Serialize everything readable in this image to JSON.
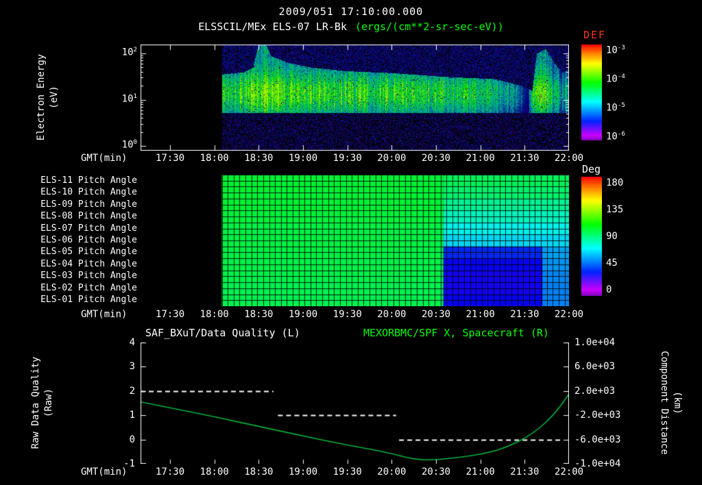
{
  "colors": {
    "background": "#000000",
    "text": "#ffffff",
    "green": "#00ff00",
    "red": "#ff3318",
    "curve_green": "#00b43c"
  },
  "header": {
    "timestamp": "2009/051 17:10:00.000",
    "instrument": "ELSSCIL/MEx ELS-07 LR-Bk",
    "units": "(ergs/(cm**2-sr-sec-eV))"
  },
  "time_axis": {
    "label": "GMT(min)",
    "start_min": 0,
    "end_min": 290,
    "ticks": [
      {
        "min": 20,
        "label": "17:30"
      },
      {
        "min": 50,
        "label": "18:00"
      },
      {
        "min": 80,
        "label": "18:30"
      },
      {
        "min": 110,
        "label": "19:00"
      },
      {
        "min": 140,
        "label": "19:30"
      },
      {
        "min": 170,
        "label": "20:00"
      },
      {
        "min": 200,
        "label": "20:30"
      },
      {
        "min": 230,
        "label": "21:00"
      },
      {
        "min": 260,
        "label": "21:30"
      },
      {
        "min": 290,
        "label": "22:00"
      }
    ]
  },
  "chart_data": [
    {
      "id": "electron_spectrogram",
      "type": "heatmap",
      "title": "ELSSCIL/MEx ELS-07 LR-Bk",
      "units": "ergs/(cm**2-sr-sec-eV)",
      "ylabel": "Electron Energy",
      "ylabel_units": "(eV)",
      "yscale": "log",
      "y_ticks": [
        {
          "base": "10",
          "exp": "2",
          "value": 2
        },
        {
          "base": "10",
          "exp": "1",
          "value": 1
        },
        {
          "base": "10",
          "exp": "0",
          "value": 0
        }
      ],
      "y_exp_top": 2.19,
      "y_exp_bottom": -0.1,
      "colorbar": {
        "title": "DEF",
        "ticks": [
          {
            "base": "10",
            "exp": "-3"
          },
          {
            "base": "10",
            "exp": "-4"
          },
          {
            "base": "10",
            "exp": "-5"
          },
          {
            "base": "10",
            "exp": "-6"
          }
        ]
      },
      "data_start_min": 55,
      "band_low_exp": 0.72,
      "band_core_exp": 1.15,
      "brightness_envelope": [
        [
          55,
          0.82
        ],
        [
          70,
          0.85
        ],
        [
          78,
          1.0
        ],
        [
          90,
          0.98
        ],
        [
          105,
          0.9
        ],
        [
          130,
          0.85
        ],
        [
          160,
          0.83
        ],
        [
          200,
          0.8
        ],
        [
          235,
          0.75
        ],
        [
          252,
          0.55
        ],
        [
          262,
          0.35
        ],
        [
          266,
          0.9
        ],
        [
          272,
          0.95
        ],
        [
          280,
          0.7
        ],
        [
          285,
          0.55
        ],
        [
          290,
          0.65
        ]
      ],
      "band_top_exp_envelope": [
        [
          55,
          1.55
        ],
        [
          70,
          1.6
        ],
        [
          76,
          1.7
        ],
        [
          80,
          2.25
        ],
        [
          84,
          2.25
        ],
        [
          88,
          1.95
        ],
        [
          100,
          1.8
        ],
        [
          115,
          1.7
        ],
        [
          140,
          1.62
        ],
        [
          170,
          1.58
        ],
        [
          205,
          1.5
        ],
        [
          240,
          1.45
        ],
        [
          258,
          1.3
        ],
        [
          265,
          1.2
        ],
        [
          268,
          2.0
        ],
        [
          274,
          2.1
        ],
        [
          280,
          1.8
        ],
        [
          285,
          1.6
        ],
        [
          290,
          1.65
        ]
      ]
    },
    {
      "id": "pitch_angles",
      "type": "heatmap",
      "colorbar": {
        "title": "Deg",
        "ticks": [
          180,
          135,
          90,
          45,
          0
        ],
        "max": 180
      },
      "data_start_min": 55,
      "grid_step_min": 4,
      "rows": [
        {
          "label": "ELS-11 Pitch Angle",
          "segments": [
            [
              55,
              205,
              100
            ],
            [
              205,
              290,
              95
            ]
          ]
        },
        {
          "label": "ELS-10 Pitch Angle",
          "segments": [
            [
              55,
              205,
              100
            ],
            [
              205,
              290,
              92
            ]
          ]
        },
        {
          "label": "ELS-09 Pitch Angle",
          "segments": [
            [
              55,
              205,
              100
            ],
            [
              205,
              290,
              86
            ]
          ]
        },
        {
          "label": "ELS-08 Pitch Angle",
          "segments": [
            [
              55,
              205,
              99
            ],
            [
              205,
              290,
              80
            ]
          ]
        },
        {
          "label": "ELS-07 Pitch Angle",
          "segments": [
            [
              55,
              205,
              98
            ],
            [
              205,
              290,
              73
            ]
          ]
        },
        {
          "label": "ELS-06 Pitch Angle",
          "segments": [
            [
              55,
              205,
              98
            ],
            [
              205,
              290,
              68
            ]
          ]
        },
        {
          "label": "ELS-05 Pitch Angle",
          "segments": [
            [
              55,
              205,
              98
            ],
            [
              205,
              272,
              42
            ],
            [
              272,
              290,
              60
            ]
          ]
        },
        {
          "label": "ELS-04 Pitch Angle",
          "segments": [
            [
              55,
              205,
              97
            ],
            [
              205,
              272,
              35
            ],
            [
              272,
              290,
              58
            ]
          ]
        },
        {
          "label": "ELS-03 Pitch Angle",
          "segments": [
            [
              55,
              205,
              97
            ],
            [
              205,
              272,
              33
            ],
            [
              272,
              290,
              56
            ]
          ]
        },
        {
          "label": "ELS-02 Pitch Angle",
          "segments": [
            [
              55,
              205,
              96
            ],
            [
              205,
              272,
              33
            ],
            [
              272,
              290,
              55
            ]
          ]
        },
        {
          "label": "ELS-01 Pitch Angle",
          "segments": [
            [
              55,
              205,
              96
            ],
            [
              205,
              272,
              35
            ],
            [
              272,
              290,
              55
            ]
          ]
        }
      ]
    },
    {
      "id": "quality_and_distance",
      "type": "line",
      "title_left": "SAF_BXuT/Data Quality (L)",
      "title_right": "MEXORBMC/SPF X, Spacecraft (R)",
      "ylabel_left": "Raw Data Quality",
      "ylabel_left_units": "(Raw)",
      "ylabel_right": "Component Distance",
      "ylabel_right_units": "(km)",
      "left_axis": {
        "min": -1,
        "max": 4,
        "ticks": [
          4,
          3,
          2,
          1,
          0,
          -1
        ]
      },
      "right_axis": {
        "min": -10000,
        "max": 10000,
        "ticks": [
          {
            "value": 10000,
            "label": "1.0e+04"
          },
          {
            "value": 6000,
            "label": "6.0e+03"
          },
          {
            "value": 2000,
            "label": "2.0e+03"
          },
          {
            "value": -2000,
            "label": "-2.0e+03"
          },
          {
            "value": -6000,
            "label": "-6.0e+03"
          },
          {
            "value": -10000,
            "label": "-1.0e+04"
          }
        ]
      },
      "quality_series": {
        "style": "dashed-steps",
        "segments": [
          {
            "t0": 0,
            "t1": 90,
            "value": 2
          },
          {
            "t0": 93,
            "t1": 173,
            "value": 1
          },
          {
            "t0": 175,
            "t1": 284,
            "value": 0
          }
        ]
      },
      "spacecraft_x_series": {
        "t_min": [
          0,
          25,
          53,
          81,
          110,
          137,
          165,
          185,
          200,
          230,
          248,
          266,
          280,
          290
        ],
        "km": [
          200,
          -1000,
          -2400,
          -3900,
          -5400,
          -6800,
          -8000,
          -9300,
          -9400,
          -8500,
          -7300,
          -5000,
          -1900,
          1500
        ]
      }
    }
  ]
}
